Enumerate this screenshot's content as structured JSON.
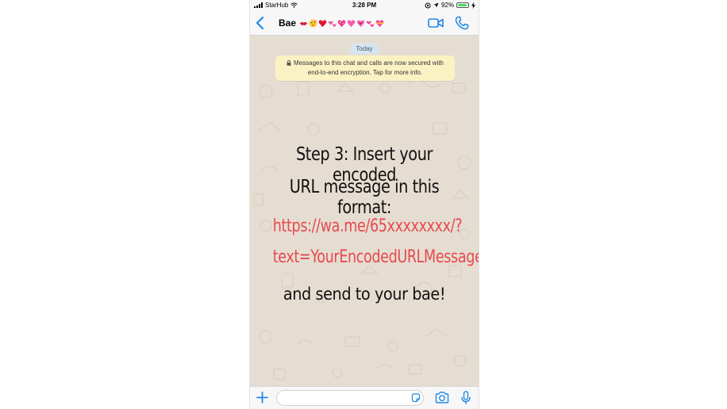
{
  "status_bar": {
    "carrier": "StarHub",
    "time": "3:28 PM",
    "battery": "92%",
    "battery_level": 0.92
  },
  "header": {
    "back_icon": "chevron-left-icon",
    "contact_name": "Bae",
    "emojis": [
      "kiss-mark",
      "kissing-face",
      "red-heart",
      "two-hearts",
      "sparkling-heart",
      "pink-heart",
      "growing-heart",
      "revolving-hearts",
      "heart-with-ribbon"
    ],
    "video_icon": "video-camera-icon",
    "call_icon": "phone-icon"
  },
  "chat": {
    "date_label": "Today",
    "system_note": "Messages to this chat and calls are now secured with end-to-end encryption. Tap for more info."
  },
  "overlay": {
    "line1": "Step 3: Insert your encoded",
    "line2": "URL message in this format:",
    "line3": "https://wa.me/65xxxxxxxx/?",
    "line4": "text=YourEncodedURLMessage",
    "line5": "and send to your bae!"
  },
  "input_bar": {
    "message_placeholder": ""
  },
  "colors": {
    "accent": "#1f88e5",
    "overlay_red": "#e64a4f",
    "system_note_bg": "#fbf2c4",
    "date_pill_bg": "#d5e6f2"
  }
}
